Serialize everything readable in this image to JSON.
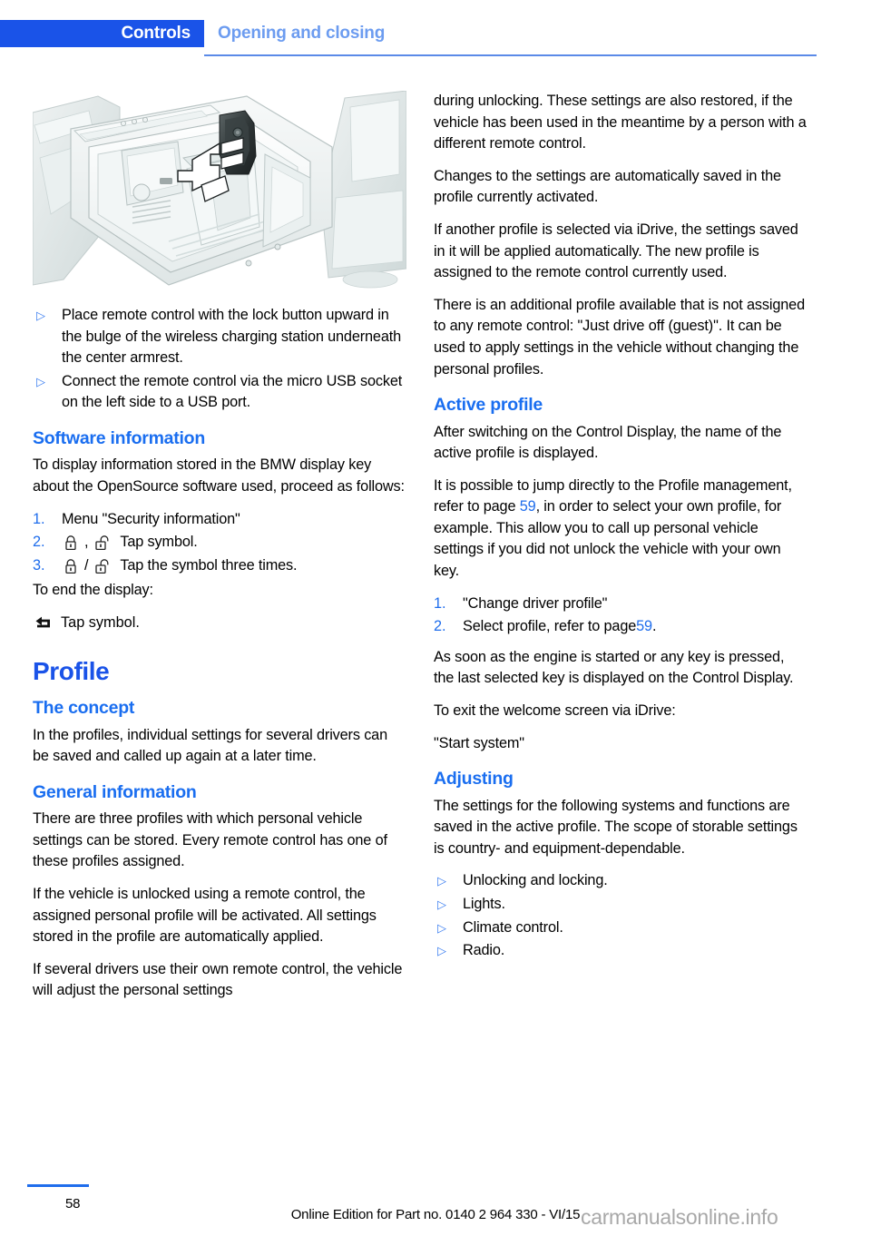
{
  "header": {
    "chapter": "Controls",
    "section": "Opening and closing"
  },
  "figure": {
    "alt_name": "center-console-wireless-charging-illustration"
  },
  "left_column": {
    "place_remote_bullets": [
      "Place remote control with the lock button upward in the bulge of the wireless charging station underneath the center armrest.",
      "Connect the remote control via the micro USB socket on the left side to a USB port."
    ],
    "software_information": {
      "heading": "Software information",
      "intro": "To display information stored in the BMW display key about the OpenSource software used, proceed as follows:",
      "steps": [
        {
          "number": "1.",
          "text": "Menu \"Security information\""
        },
        {
          "number": "2.",
          "symbols": [
            "lock-closed-icon",
            "lock-open-icon"
          ],
          "separator": ",",
          "text": "Tap symbol."
        },
        {
          "number": "3.",
          "symbols": [
            "lock-closed-icon",
            "lock-open-icon"
          ],
          "separator": "/",
          "text": "Tap the symbol three times."
        }
      ],
      "end_intro": "To end the display:",
      "end_step": {
        "symbol": "back-arrow-icon",
        "text": "Tap symbol."
      }
    },
    "profile": {
      "heading": "Profile",
      "the_concept": {
        "heading": "The concept",
        "body": "In the profiles, individual settings for several drivers can be saved and called up again at a later time."
      },
      "general_information": {
        "heading": "General information",
        "paragraphs": [
          "There are three profiles with which personal vehicle settings can be stored. Every remote control has one of these profiles assigned.",
          "If the vehicle is unlocked using a remote control, the assigned personal profile will be activated. All settings stored in the profile are automatically applied.",
          "If several drivers use their own remote control, the vehicle will adjust the personal settings"
        ]
      }
    }
  },
  "right_column": {
    "continuation_paragraphs": [
      "during unlocking. These settings are also restored, if the vehicle has been used in the meantime by a person with a different remote control.",
      "Changes to the settings are automatically saved in the profile currently activated.",
      "If another profile is selected via iDrive, the settings saved in it will be applied automatically. The new profile is assigned to the remote control currently used.",
      "There is an additional profile available that is not assigned to any remote control: \"Just drive off (guest)\". It can be used to apply settings in the vehicle without changing the personal profiles."
    ],
    "active_profile": {
      "heading": "Active profile",
      "para1": "After switching on the Control Display, the name of the active profile is displayed.",
      "para2_before": "It is possible to jump directly to the Profile management, refer to page ",
      "para2_link": "59",
      "para2_after": ", in order to select your own profile, for example. This allow you to call up personal vehicle settings if you did not unlock the vehicle with your own key.",
      "steps": [
        {
          "number": "1.",
          "text": "\"Change driver profile\""
        }
      ],
      "step2_number": "2.",
      "step2_before": "Select profile, refer to page ",
      "step2_link": "59",
      "step2_after": ".",
      "para3": "As soon as the engine is started or any key is pressed, the last selected key is displayed on the Control Display.",
      "para4": "To exit the welcome screen via iDrive:",
      "para5": "\"Start system\""
    },
    "adjusting": {
      "heading": "Adjusting",
      "intro": "The settings for the following systems and functions are saved in the active profile. The scope of storable settings is country- and equipment-dependable.",
      "bullets": [
        "Unlocking and locking.",
        "Lights.",
        "Climate control.",
        "Radio."
      ]
    }
  },
  "footer": {
    "page_number": "58",
    "edition": "Online Edition for Part no. 0140 2 964 330 - VI/15",
    "watermark": "carmanualsonline.info"
  },
  "colors": {
    "chapter_tab_bg": "#1a53e8",
    "section_text": "#6c9cf0",
    "heading_blue": "#1a53e8",
    "subheading_blue": "#1a6ef0",
    "bullet_blue": "#3b7ef0",
    "link_blue": "#1f6dec"
  }
}
